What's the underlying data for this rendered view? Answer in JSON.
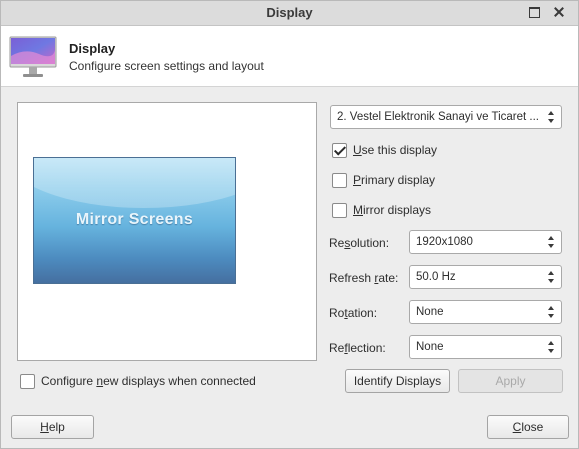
{
  "window": {
    "title": "Display"
  },
  "header": {
    "title": "Display",
    "subtitle": "Configure screen settings and layout"
  },
  "preview": {
    "screen_label": "Mirror Screens"
  },
  "configure_new": {
    "label_pre": "Configure ",
    "label_key": "n",
    "label_post": "ew displays when connected",
    "checked": false
  },
  "monitor_select": {
    "value": "2. Vestel Elektronik Sanayi ve Ticaret ..."
  },
  "options": {
    "use_display": {
      "label_key": "U",
      "label_post": "se this display",
      "checked": true
    },
    "primary": {
      "label_key": "P",
      "label_post": "rimary display",
      "checked": false
    },
    "mirror": {
      "label_key": "M",
      "label_post": "irror displays",
      "checked": false
    }
  },
  "fields": {
    "resolution": {
      "label_pre": "Re",
      "label_key": "s",
      "label_post": "olution:",
      "value": "1920x1080"
    },
    "refresh": {
      "label_pre": "Refresh ",
      "label_key": "r",
      "label_post": "ate:",
      "value": "50.0 Hz"
    },
    "rotation": {
      "label_pre": "Ro",
      "label_key": "t",
      "label_post": "ation:",
      "value": "None"
    },
    "reflection": {
      "label_pre": "Re",
      "label_key": "f",
      "label_post": "lection:",
      "value": "None"
    }
  },
  "buttons": {
    "identify": "Identify Displays",
    "apply": "Apply",
    "help_key": "H",
    "help_post": "elp",
    "close_key": "C",
    "close_post": "lose"
  }
}
